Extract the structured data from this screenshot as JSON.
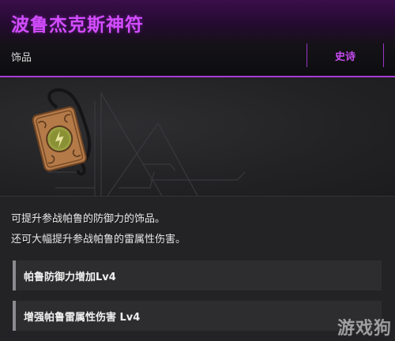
{
  "item": {
    "name": "波鲁杰克斯神符",
    "category": "饰品",
    "rarity": "史诗",
    "rarity_color": "#c84cf2",
    "icon": "lightning-amulet-icon"
  },
  "description": {
    "line1": "可提升参战帕鲁的防御力的饰品。",
    "line2": "还可大幅提升参战帕鲁的雷属性伤害。"
  },
  "stats": [
    {
      "label": "帕鲁防御力增加Lv4"
    },
    {
      "label": "增强帕鲁雷属性伤害 Lv4"
    }
  ],
  "watermark": "游戏狗"
}
